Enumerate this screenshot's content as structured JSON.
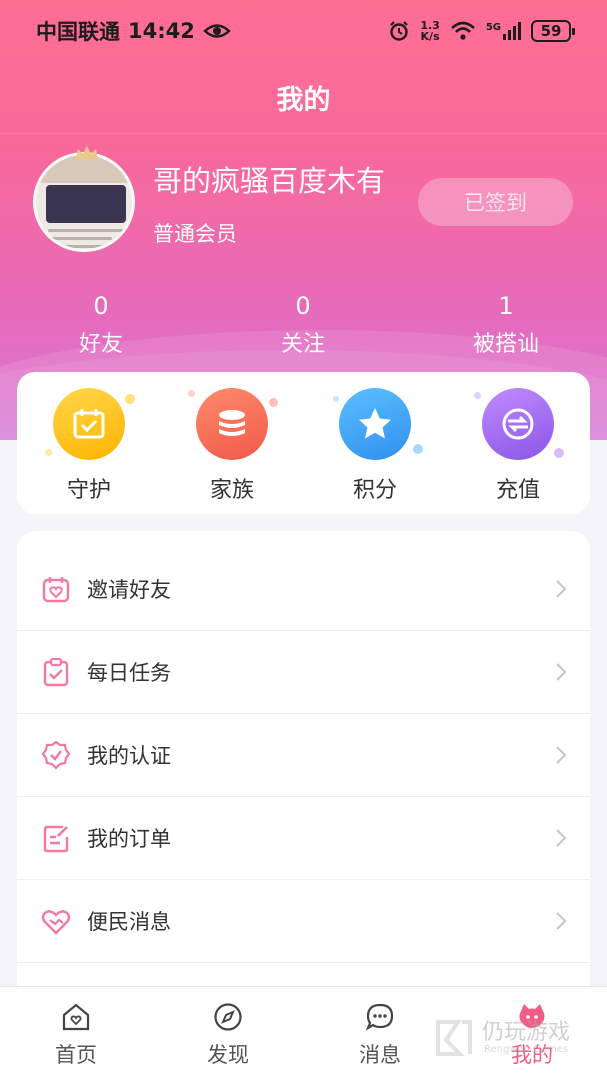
{
  "status_bar": {
    "carrier": "中国联通",
    "time": "14:42",
    "speed_value": "1.3",
    "speed_unit": "K/s",
    "network": "5G",
    "battery": "59"
  },
  "page": {
    "title": "我的"
  },
  "profile": {
    "username": "哥的疯骚百度木有",
    "member_level": "普通会员",
    "signin_label": "已签到"
  },
  "stats": [
    {
      "value": "0",
      "label": "好友"
    },
    {
      "value": "0",
      "label": "关注"
    },
    {
      "value": "1",
      "label": "被搭讪"
    }
  ],
  "features": [
    {
      "label": "守护",
      "icon": "calendar-check-icon",
      "color": "#ffc21a"
    },
    {
      "label": "家族",
      "icon": "coin-stack-icon",
      "color": "#f6735a"
    },
    {
      "label": "积分",
      "icon": "star-icon",
      "color": "#3fa5f5"
    },
    {
      "label": "充值",
      "icon": "recharge-icon",
      "color": "#a66ef0"
    }
  ],
  "menu": [
    {
      "label": "邀请好友",
      "icon": "invite-icon"
    },
    {
      "label": "每日任务",
      "icon": "clipboard-check-icon"
    },
    {
      "label": "我的认证",
      "icon": "badge-check-icon"
    },
    {
      "label": "我的订单",
      "icon": "order-edit-icon"
    },
    {
      "label": "便民消息",
      "icon": "handshake-heart-icon"
    }
  ],
  "accent_color": "#f25d86",
  "bottom_nav": [
    {
      "label": "首页",
      "icon": "home-heart-icon"
    },
    {
      "label": "发现",
      "icon": "compass-icon"
    },
    {
      "label": "消息",
      "icon": "chat-bubble-icon"
    },
    {
      "label": "我的",
      "icon": "profile-cat-icon",
      "active": true
    }
  ],
  "watermark": {
    "text": "仍玩游戏",
    "sub": "Rengwan Games"
  }
}
